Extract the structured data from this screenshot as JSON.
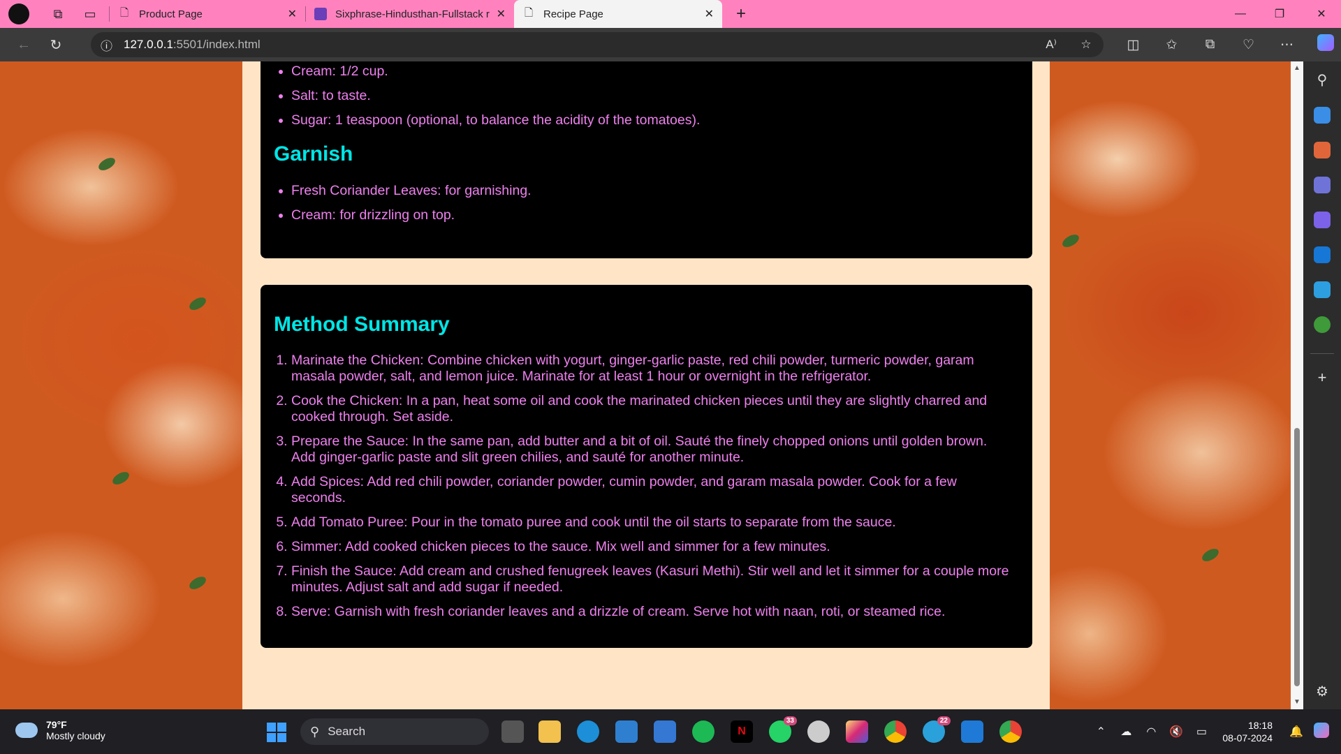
{
  "browser": {
    "tabs": [
      {
        "title": "Product Page",
        "active": false
      },
      {
        "title": "Sixphrase-Hindusthan-Fullstack r",
        "active": false
      },
      {
        "title": "Recipe Page",
        "active": true
      }
    ],
    "url_host": "127.0.0.1",
    "url_path": ":5501/index.html"
  },
  "page": {
    "ingredients_list": [
      "Cream: 1/2 cup.",
      "Salt: to taste.",
      "Sugar: 1 teaspoon (optional, to balance the acidity of the tomatoes)."
    ],
    "garnish_title": "Garnish",
    "garnish_list": [
      "Fresh Coriander Leaves: for garnishing.",
      "Cream: for drizzling on top."
    ],
    "method_title": "Method Summary",
    "method_steps": [
      "Marinate the Chicken: Combine chicken with yogurt, ginger-garlic paste, red chili powder, turmeric powder, garam masala powder, salt, and lemon juice. Marinate for at least 1 hour or overnight in the refrigerator.",
      "Cook the Chicken: In a pan, heat some oil and cook the marinated chicken pieces until they are slightly charred and cooked through. Set aside.",
      "Prepare the Sauce: In the same pan, add butter and a bit of oil. Sauté the finely chopped onions until golden brown. Add ginger-garlic paste and slit green chilies, and sauté for another minute.",
      "Add Spices: Add red chili powder, coriander powder, cumin powder, and garam masala powder. Cook for a few seconds.",
      "Add Tomato Puree: Pour in the tomato puree and cook until the oil starts to separate from the sauce.",
      "Simmer: Add cooked chicken pieces to the sauce. Mix well and simmer for a few minutes.",
      "Finish the Sauce: Add cream and crushed fenugreek leaves (Kasuri Methi). Stir well and let it simmer for a couple more minutes. Adjust salt and add sugar if needed.",
      "Serve: Garnish with fresh coriander leaves and a drizzle of cream. Serve hot with naan, roti, or steamed rice."
    ],
    "colors": {
      "heading": "#00e5e5",
      "text": "#ee80ee",
      "card": "#ffe5c6",
      "section": "#000000"
    }
  },
  "taskbar": {
    "weather_temp": "79°F",
    "weather_desc": "Mostly cloudy",
    "search_label": "Search",
    "whatsapp_badge": "33",
    "telegram_badge": "22",
    "time": "18:18",
    "date": "08-07-2024"
  }
}
